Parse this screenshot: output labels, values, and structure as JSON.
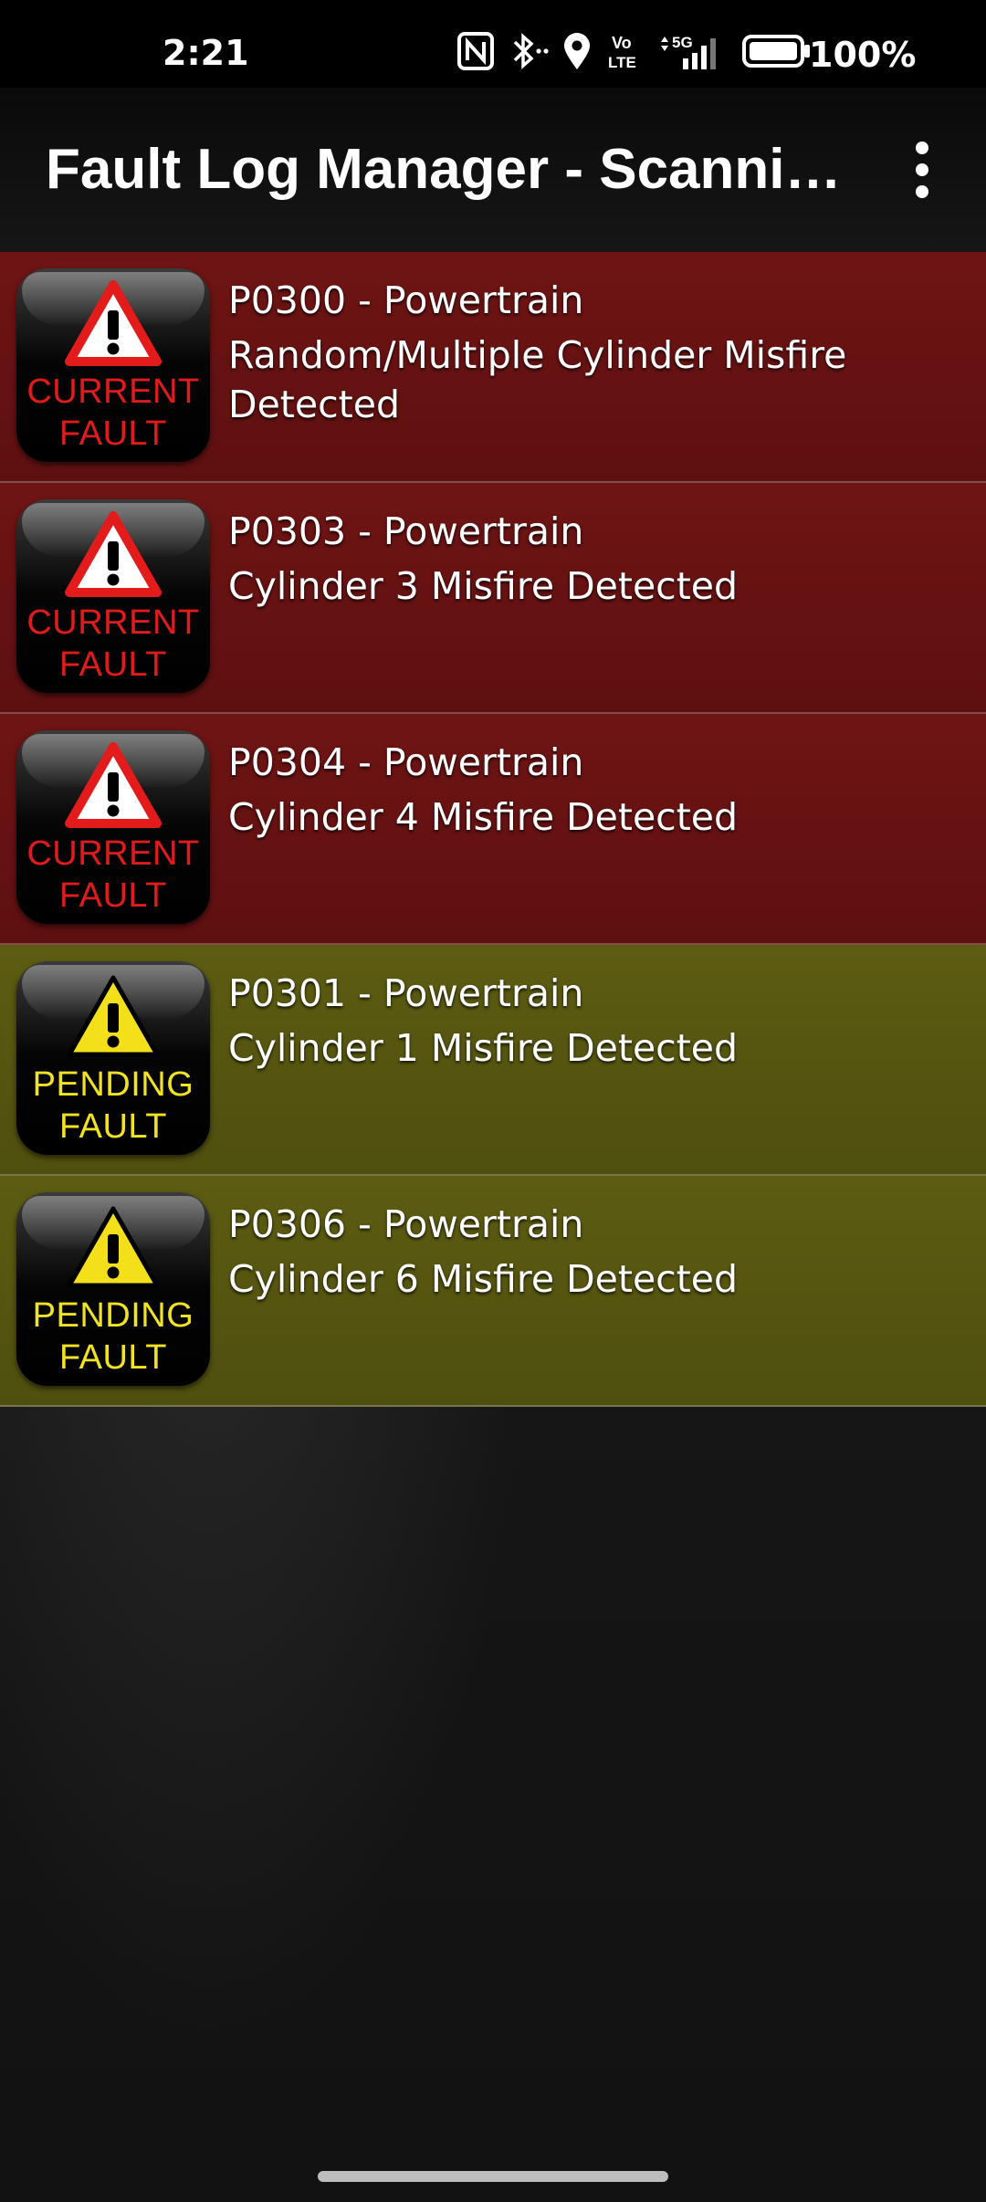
{
  "status_bar": {
    "time": "2:21",
    "battery_percent": "100%",
    "icons": [
      "nfc-icon",
      "bluetooth-icon",
      "location-icon",
      "volte-icon",
      "5g-signal-icon",
      "battery-icon"
    ],
    "volte_label_1": "Vo",
    "volte_label_2": "LTE",
    "network_label": "5G"
  },
  "app_bar": {
    "title": "Fault Log Manager - Scanning...",
    "menu_icon": "more-vert-icon"
  },
  "faults": [
    {
      "status": "current",
      "badge_line1": "CURRENT",
      "badge_line2": "FAULT",
      "code": "P0300 - Powertrain",
      "description": "Random/Multiple Cylinder Misfire Detected"
    },
    {
      "status": "current",
      "badge_line1": "CURRENT",
      "badge_line2": "FAULT",
      "code": "P0303 - Powertrain",
      "description": "Cylinder 3 Misfire Detected"
    },
    {
      "status": "current",
      "badge_line1": "CURRENT",
      "badge_line2": "FAULT",
      "code": "P0304 - Powertrain",
      "description": "Cylinder 4 Misfire Detected"
    },
    {
      "status": "pending",
      "badge_line1": "PENDING",
      "badge_line2": "FAULT",
      "code": "P0301 - Powertrain",
      "description": "Cylinder 1 Misfire Detected"
    },
    {
      "status": "pending",
      "badge_line1": "PENDING",
      "badge_line2": "FAULT",
      "code": "P0306 - Powertrain",
      "description": "Cylinder 6 Misfire Detected"
    }
  ],
  "colors": {
    "current_row": "#6f1414",
    "pending_row": "#5d5c12",
    "current_badge_text": "#e01b1b",
    "pending_badge_text": "#f1e222",
    "warning_red": "#e31b1b",
    "warning_yellow": "#f4e01a"
  }
}
